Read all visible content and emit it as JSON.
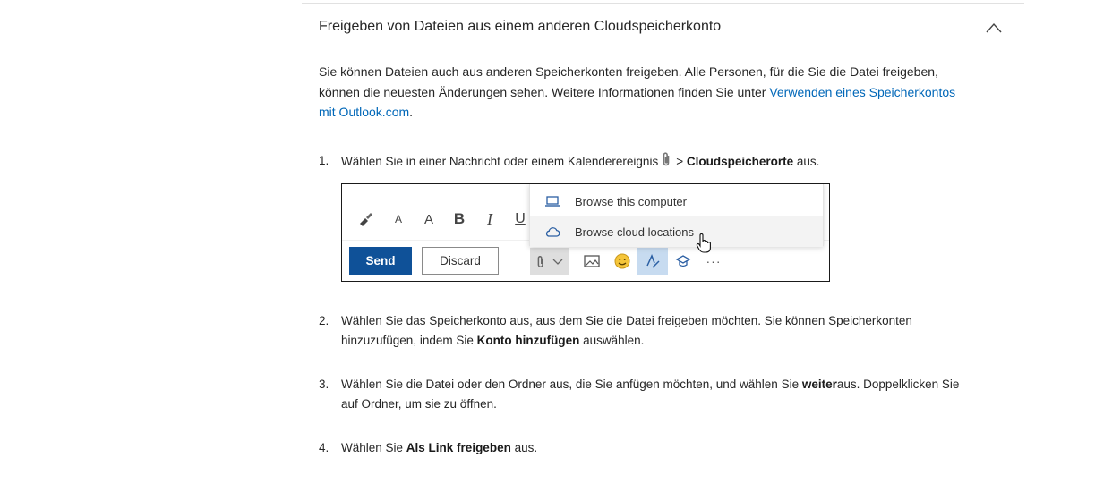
{
  "section": {
    "title": "Freigeben von Dateien aus einem anderen Cloudspeicherkonto"
  },
  "intro": {
    "text": "Sie können Dateien auch aus anderen Speicherkonten freigeben. Alle Personen, für die Sie die Datei freigeben, können die neuesten Änderungen sehen. Weitere Informationen finden Sie unter ",
    "link_text": "Verwenden eines Speicherkontos mit Outlook.com",
    "after_link": "."
  },
  "steps": [
    {
      "number": "1.",
      "before": "Wählen Sie in einer Nachricht oder einem Kalenderereignis",
      "separator": ">",
      "bold": "Cloudspeicherorte",
      "after": " aus."
    },
    {
      "number": "2.",
      "before": "Wählen Sie das Speicherkonto aus, aus dem Sie die Datei freigeben möchten. Sie können Speicherkonten hinzuzufügen, indem Sie ",
      "bold": "Konto hinzufügen",
      "after": " auswählen."
    },
    {
      "number": "3.",
      "before": "Wählen Sie die Datei oder den Ordner aus, die Sie anfügen möchten, und wählen Sie ",
      "bold": "weiter",
      "after": "aus. Doppelklicken Sie auf Ordner, um sie zu öffnen."
    },
    {
      "number": "4.",
      "before": "Wählen Sie ",
      "bold": "Als Link freigeben",
      "after": " aus."
    }
  ],
  "figure": {
    "format_labels": [
      "A",
      "A",
      "B",
      "I",
      "U"
    ],
    "send_label": "Send",
    "discard_label": "Discard",
    "menu": [
      {
        "label": "Browse this computer",
        "icon": "laptop-icon"
      },
      {
        "label": "Browse cloud locations",
        "icon": "cloud-icon"
      }
    ],
    "more_label": "···"
  },
  "colors": {
    "link": "#0067b8",
    "send_button": "#0f5198",
    "active_icon_bg": "#c7dbf0"
  }
}
